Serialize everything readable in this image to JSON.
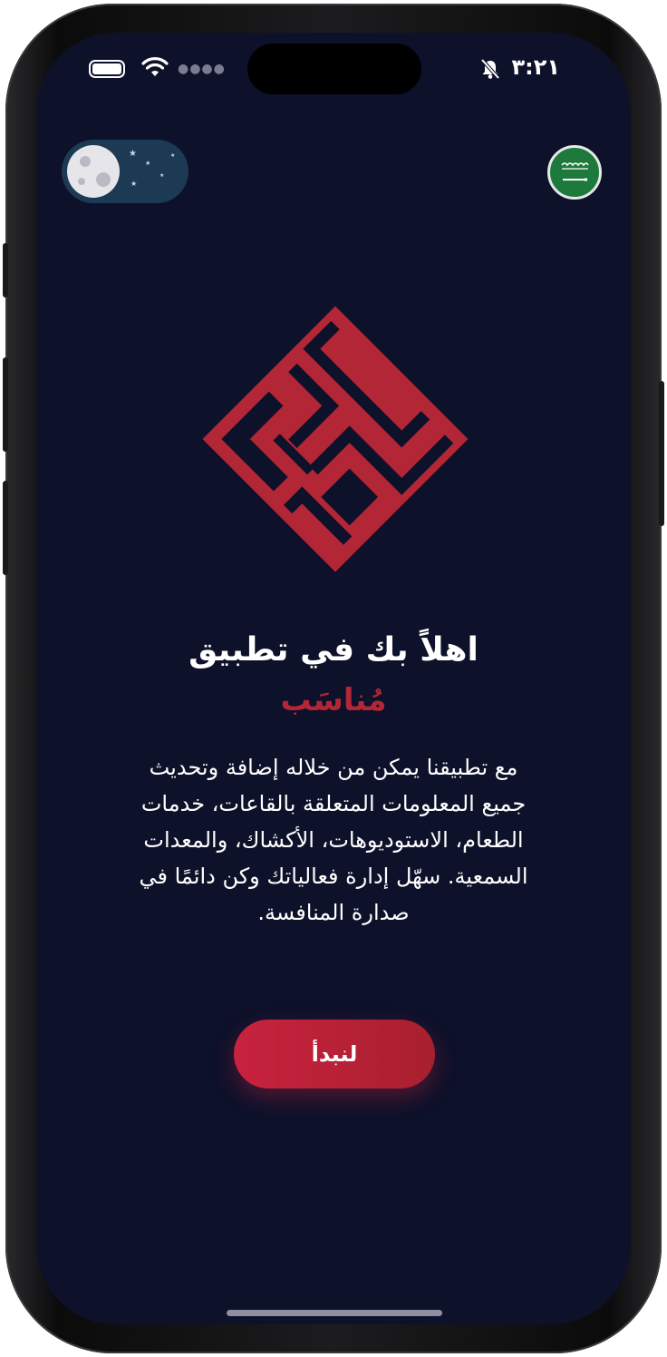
{
  "status_bar": {
    "time": "٣:٢١",
    "battery_icon": "battery-icon",
    "wifi_icon": "wifi-icon",
    "signal_icon": "signal-dots-icon",
    "silent_icon": "bell-slash-icon"
  },
  "header": {
    "theme_toggle": {
      "state": "dark",
      "icon": "moon-icon"
    },
    "language_icon": "saudi-flag-icon"
  },
  "logo": {
    "icon": "kufic-logo-icon",
    "color": "#b22636"
  },
  "content": {
    "welcome": "اهلاً بك في تطبيق",
    "brand": "مُناسَب",
    "description": "مع تطبيقنا يمكن من خلاله إضافة وتحديث جميع المعلومات المتعلقة بالقاعات، خدمات الطعام، الاستوديوهات، الأكشاك، والمعدات السمعية. سهّل إدارة فعالياتك وكن دائمًا في صدارة المنافسة."
  },
  "actions": {
    "start_label": "لنبدأ"
  },
  "colors": {
    "background": "#0e112a",
    "accent": "#b22636",
    "button": "#c8223e",
    "text": "#ffffff"
  }
}
